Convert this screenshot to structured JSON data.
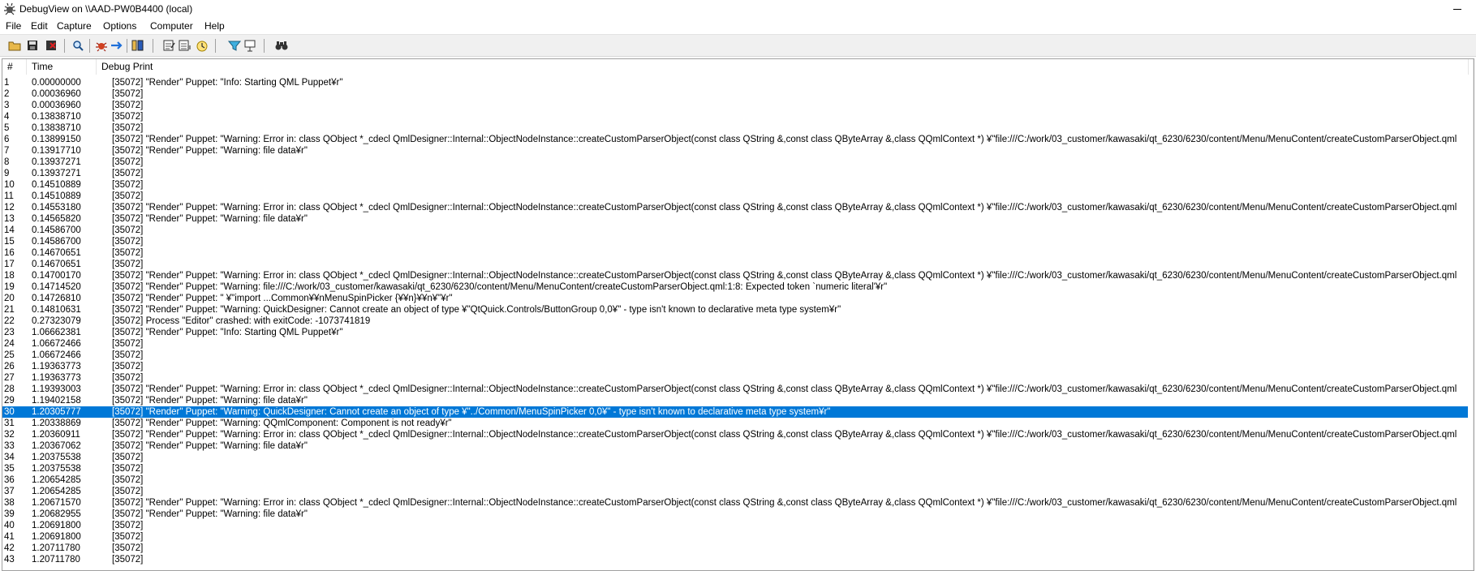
{
  "window": {
    "title": "DebugView on \\\\AAD-PW0B4400 (local)",
    "minimize_label": "minimize"
  },
  "menu": [
    "File",
    "Edit",
    "Capture",
    "Options",
    "Computer",
    "Help"
  ],
  "toolbar": [
    "open-icon",
    "save-icon",
    "clear-icon",
    "find-icon",
    "capture-icon",
    "autoscroll-icon",
    "filter-icon",
    "clock-time-icon",
    "options-icon",
    "history-icon",
    "highlight-icon",
    "log-boot-icon",
    "find-next-icon"
  ],
  "columns": {
    "num": "#",
    "time": "Time",
    "debug_print": "Debug Print"
  },
  "selected_row": 30,
  "rows": [
    {
      "n": "1",
      "t": "0.00000000",
      "msg": "[35072] \"Render\" Puppet: \"Info: Starting QML Puppet¥r\""
    },
    {
      "n": "2",
      "t": "0.00036960",
      "msg": "[35072]"
    },
    {
      "n": "3",
      "t": "0.00036960",
      "msg": "[35072]"
    },
    {
      "n": "4",
      "t": "0.13838710",
      "msg": "[35072]"
    },
    {
      "n": "5",
      "t": "0.13838710",
      "msg": "[35072]"
    },
    {
      "n": "6",
      "t": "0.13899150",
      "msg": "[35072] \"Render\" Puppet: \"Warning: Error in: class QObject *_cdecl QmlDesigner::Internal::ObjectNodeInstance::createCustomParserObject(const class QString &,const class QByteArray &,class QQmlContext *) ¥\"file:///C:/work/03_customer/kawasaki/qt_6230/6230/content/Menu/MenuContent/createCustomParserObject.qml"
    },
    {
      "n": "7",
      "t": "0.13917710",
      "msg": "[35072] \"Render\" Puppet: \"Warning: file data¥r\""
    },
    {
      "n": "8",
      "t": "0.13937271",
      "msg": "[35072]"
    },
    {
      "n": "9",
      "t": "0.13937271",
      "msg": "[35072]"
    },
    {
      "n": "10",
      "t": "0.14510889",
      "msg": "[35072]"
    },
    {
      "n": "11",
      "t": "0.14510889",
      "msg": "[35072]"
    },
    {
      "n": "12",
      "t": "0.14553180",
      "msg": "[35072] \"Render\" Puppet: \"Warning: Error in: class QObject *_cdecl QmlDesigner::Internal::ObjectNodeInstance::createCustomParserObject(const class QString &,const class QByteArray &,class QQmlContext *) ¥\"file:///C:/work/03_customer/kawasaki/qt_6230/6230/content/Menu/MenuContent/createCustomParserObject.qml"
    },
    {
      "n": "13",
      "t": "0.14565820",
      "msg": "[35072] \"Render\" Puppet: \"Warning: file data¥r\""
    },
    {
      "n": "14",
      "t": "0.14586700",
      "msg": "[35072]"
    },
    {
      "n": "15",
      "t": "0.14586700",
      "msg": "[35072]"
    },
    {
      "n": "16",
      "t": "0.14670651",
      "msg": "[35072]"
    },
    {
      "n": "17",
      "t": "0.14670651",
      "msg": "[35072]"
    },
    {
      "n": "18",
      "t": "0.14700170",
      "msg": "[35072] \"Render\" Puppet: \"Warning: Error in: class QObject *_cdecl QmlDesigner::Internal::ObjectNodeInstance::createCustomParserObject(const class QString &,const class QByteArray &,class QQmlContext *) ¥\"file:///C:/work/03_customer/kawasaki/qt_6230/6230/content/Menu/MenuContent/createCustomParserObject.qml"
    },
    {
      "n": "19",
      "t": "0.14714520",
      "msg": "[35072] \"Render\" Puppet: \"Warning: file:///C:/work/03_customer/kawasaki/qt_6230/6230/content/Menu/MenuContent/createCustomParserObject.qml:1:8: Expected token `numeric literal'¥r\""
    },
    {
      "n": "20",
      "t": "0.14726810",
      "msg": "[35072] \"Render\" Puppet: \" ¥\"import ...Common¥¥nMenuSpinPicker {¥¥n}¥¥n¥\"¥r\""
    },
    {
      "n": "21",
      "t": "0.14810631",
      "msg": "[35072] \"Render\" Puppet: \"Warning: QuickDesigner: Cannot create an object of type ¥\"QtQuick.Controls/ButtonGroup 0,0¥\" - type isn't known to declarative meta type system¥r\""
    },
    {
      "n": "22",
      "t": "0.27323079",
      "msg": "[35072] Process \"Editor\" crashed: with exitCode: -1073741819"
    },
    {
      "n": "23",
      "t": "1.06662381",
      "msg": "[35072] \"Render\" Puppet: \"Info: Starting QML Puppet¥r\""
    },
    {
      "n": "24",
      "t": "1.06672466",
      "msg": "[35072]"
    },
    {
      "n": "25",
      "t": "1.06672466",
      "msg": "[35072]"
    },
    {
      "n": "26",
      "t": "1.19363773",
      "msg": "[35072]"
    },
    {
      "n": "27",
      "t": "1.19363773",
      "msg": "[35072]"
    },
    {
      "n": "28",
      "t": "1.19393003",
      "msg": "[35072] \"Render\" Puppet: \"Warning: Error in: class QObject *_cdecl QmlDesigner::Internal::ObjectNodeInstance::createCustomParserObject(const class QString &,const class QByteArray &,class QQmlContext *) ¥\"file:///C:/work/03_customer/kawasaki/qt_6230/6230/content/Menu/MenuContent/createCustomParserObject.qml"
    },
    {
      "n": "29",
      "t": "1.19402158",
      "msg": "[35072] \"Render\" Puppet: \"Warning: file data¥r\""
    },
    {
      "n": "30",
      "t": "1.20305777",
      "msg": "[35072] \"Render\" Puppet: \"Warning: QuickDesigner: Cannot create an object of type ¥\"../Common/MenuSpinPicker 0,0¥\" - type isn't known to declarative meta type system¥r\""
    },
    {
      "n": "31",
      "t": "1.20338869",
      "msg": "[35072] \"Render\" Puppet: \"Warning: QQmlComponent: Component is not ready¥r\""
    },
    {
      "n": "32",
      "t": "1.20360911",
      "msg": "[35072] \"Render\" Puppet: \"Warning: Error in: class QObject *_cdecl QmlDesigner::Internal::ObjectNodeInstance::createCustomParserObject(const class QString &,const class QByteArray &,class QQmlContext *) ¥\"file:///C:/work/03_customer/kawasaki/qt_6230/6230/content/Menu/MenuContent/createCustomParserObject.qml"
    },
    {
      "n": "33",
      "t": "1.20367062",
      "msg": "[35072] \"Render\" Puppet: \"Warning: file data¥r\""
    },
    {
      "n": "34",
      "t": "1.20375538",
      "msg": "[35072]"
    },
    {
      "n": "35",
      "t": "1.20375538",
      "msg": "[35072]"
    },
    {
      "n": "36",
      "t": "1.20654285",
      "msg": "[35072]"
    },
    {
      "n": "37",
      "t": "1.20654285",
      "msg": "[35072]"
    },
    {
      "n": "38",
      "t": "1.20671570",
      "msg": "[35072] \"Render\" Puppet: \"Warning: Error in: class QObject *_cdecl QmlDesigner::Internal::ObjectNodeInstance::createCustomParserObject(const class QString &,const class QByteArray &,class QQmlContext *) ¥\"file:///C:/work/03_customer/kawasaki/qt_6230/6230/content/Menu/MenuContent/createCustomParserObject.qml"
    },
    {
      "n": "39",
      "t": "1.20682955",
      "msg": "[35072] \"Render\" Puppet: \"Warning: file data¥r\""
    },
    {
      "n": "40",
      "t": "1.20691800",
      "msg": "[35072]"
    },
    {
      "n": "41",
      "t": "1.20691800",
      "msg": "[35072]"
    },
    {
      "n": "42",
      "t": "1.20711780",
      "msg": "[35072]"
    },
    {
      "n": "43",
      "t": "1.20711780",
      "msg": "[35072]"
    }
  ]
}
